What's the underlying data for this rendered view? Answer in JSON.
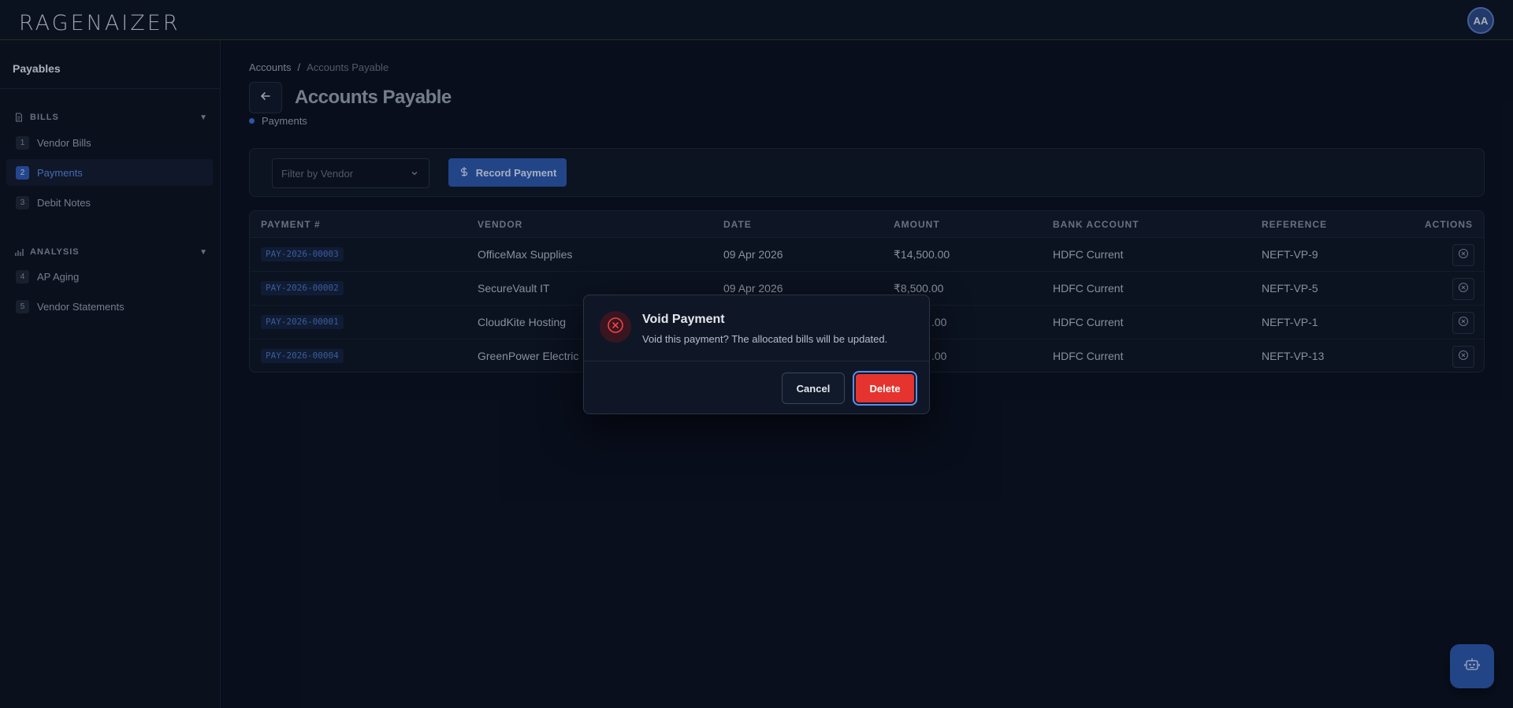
{
  "app": {
    "logo": "RAGENAIZER",
    "user_initials": "AA"
  },
  "sidebar": {
    "title": "Payables",
    "sections": [
      {
        "label": "BILLS",
        "icon": "document-icon",
        "items": [
          {
            "num": "1",
            "label": "Vendor Bills",
            "active": false
          },
          {
            "num": "2",
            "label": "Payments",
            "active": true
          },
          {
            "num": "3",
            "label": "Debit Notes",
            "active": false
          }
        ]
      },
      {
        "label": "ANALYSIS",
        "icon": "bar-chart-icon",
        "items": [
          {
            "num": "4",
            "label": "AP Aging",
            "active": false
          },
          {
            "num": "5",
            "label": "Vendor Statements",
            "active": false
          }
        ]
      }
    ]
  },
  "breadcrumb": {
    "root": "Accounts",
    "separator": "/",
    "current": "Accounts Payable"
  },
  "page": {
    "title": "Accounts Payable",
    "subtag": "Payments"
  },
  "toolbar": {
    "filter_placeholder": "Filter by Vendor",
    "record_label": "Record Payment"
  },
  "table": {
    "headers": [
      "PAYMENT #",
      "VENDOR",
      "DATE",
      "AMOUNT",
      "BANK ACCOUNT",
      "REFERENCE",
      "ACTIONS"
    ],
    "rows": [
      {
        "id": "PAY-2026-00003",
        "vendor": "OfficeMax Supplies",
        "date": "09 Apr 2026",
        "amount": "₹14,500.00",
        "bank": "HDFC Current",
        "ref": "NEFT-VP-9"
      },
      {
        "id": "PAY-2026-00002",
        "vendor": "SecureVault IT",
        "date": "09 Apr 2026",
        "amount": "₹8,500.00",
        "bank": "HDFC Current",
        "ref": "NEFT-VP-5"
      },
      {
        "id": "PAY-2026-00001",
        "vendor": "CloudKite Hosting",
        "date": "",
        "amount": ".00",
        "bank": "HDFC Current",
        "ref": "NEFT-VP-1"
      },
      {
        "id": "PAY-2026-00004",
        "vendor": "GreenPower Electric",
        "date": "",
        "amount": ".00",
        "bank": "HDFC Current",
        "ref": "NEFT-VP-13"
      }
    ]
  },
  "modal": {
    "title": "Void Payment",
    "message": "Void this payment? The allocated bills will be updated.",
    "cancel_label": "Cancel",
    "confirm_label": "Delete"
  },
  "colors": {
    "accent": "#2d5ab0",
    "danger": "#e5342f",
    "background": "#0b1120"
  }
}
